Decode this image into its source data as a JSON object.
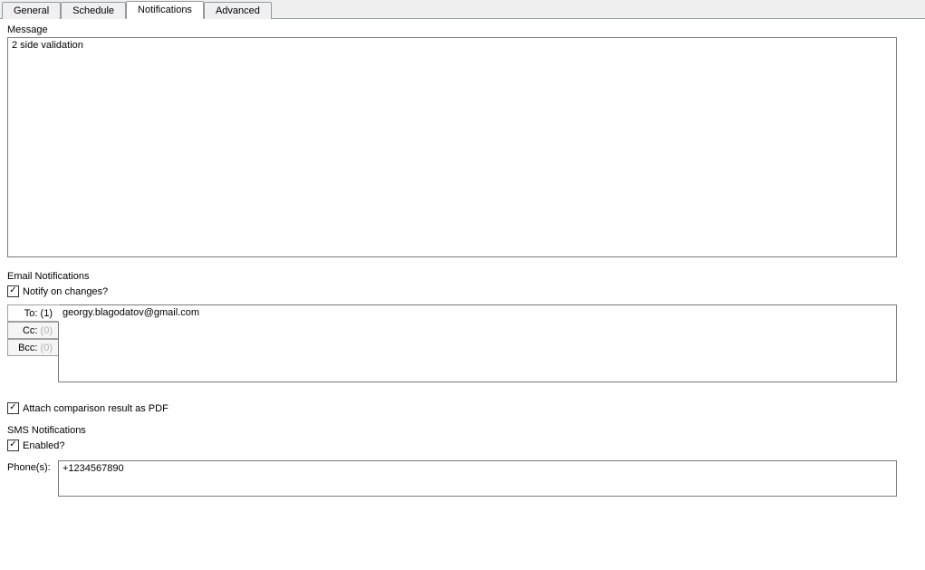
{
  "tabs": {
    "general": "General",
    "schedule": "Schedule",
    "notifications": "Notifications",
    "advanced": "Advanced"
  },
  "message": {
    "label": "Message",
    "value": "2 side validation"
  },
  "email": {
    "section_label": "Email Notifications",
    "notify_label": "Notify on changes?",
    "notify_checked": true,
    "to_label": "To:",
    "to_count": "(1)",
    "cc_label": "Cc:",
    "cc_count": "(0)",
    "bcc_label": "Bcc:",
    "bcc_count": "(0)",
    "recipients_value": "georgy.blagodatov@gmail.com",
    "attach_label": "Attach comparison result as PDF",
    "attach_checked": true
  },
  "sms": {
    "section_label": "SMS Notifications",
    "enabled_label": "Enabled?",
    "enabled_checked": true,
    "phones_label": "Phone(s):",
    "phones_value": "+1234567890"
  }
}
